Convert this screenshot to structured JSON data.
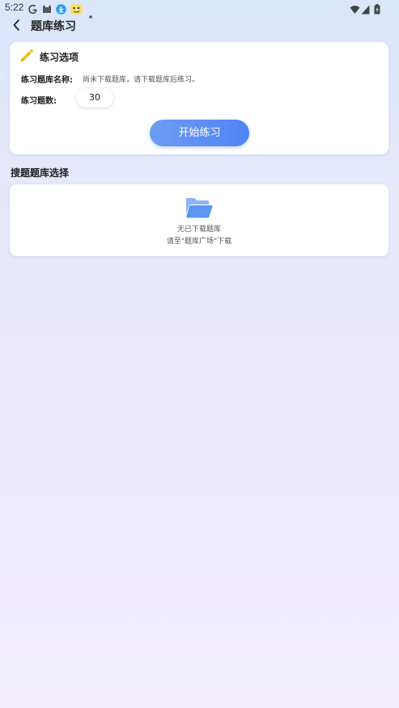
{
  "status_bar": {
    "time": "5:22"
  },
  "header": {
    "title": "题库练习"
  },
  "options_card": {
    "title": "练习选项",
    "bank_name_label": "练习题库名称:",
    "bank_name_value": "尚未下载题库，请下载题库后练习。",
    "count_label": "练习题数:",
    "count_value": "30",
    "start_button": "开始练习"
  },
  "bank_section": {
    "title": "搜题题库选择",
    "empty_line1": "无已下载题库",
    "empty_line2": "请至\"题库广场\"下载"
  },
  "colors": {
    "accent": "#5588f4",
    "pencil": "#f0b90b",
    "folder": "#6b9ff5"
  }
}
